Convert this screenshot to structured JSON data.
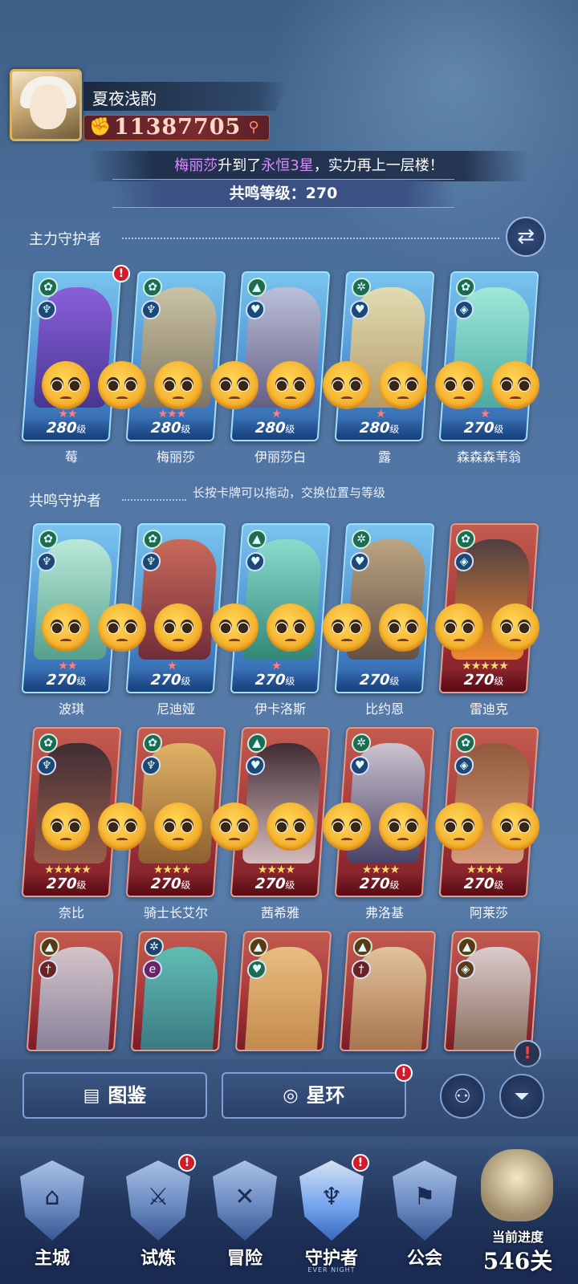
{
  "player": {
    "name": "夏夜浅酌",
    "power": "11387705"
  },
  "news": {
    "hero": "梅丽莎",
    "mid": "升到了",
    "rank": "永恒3星",
    "tail": "，实力再上一层楼！"
  },
  "resonance_level": "共鸣等级：270",
  "sections": {
    "main": "主力守护者",
    "resonance": "共鸣守护者",
    "hint": "长按卡牌可以拖动，交换位置与等级"
  },
  "level_unit": "级",
  "main_cards": [
    {
      "name": "莓",
      "level": "280",
      "stars": "★★"
    },
    {
      "name": "梅丽莎",
      "level": "280",
      "stars": "★★★"
    },
    {
      "name": "伊丽莎白",
      "level": "280",
      "stars": "★"
    },
    {
      "name": "露",
      "level": "280",
      "stars": "★"
    },
    {
      "name": "森森森苇翁",
      "level": "270",
      "stars": "★"
    }
  ],
  "resonance_row1": [
    {
      "name": "波琪",
      "level": "270",
      "stars": "★★"
    },
    {
      "name": "尼迪娅",
      "level": "270",
      "stars": "★"
    },
    {
      "name": "伊卡洛斯",
      "level": "270",
      "stars": "★"
    },
    {
      "name": "比约恩",
      "level": "270",
      "stars": ""
    },
    {
      "name": "雷迪克",
      "level": "270",
      "stars": "★★★★★"
    }
  ],
  "resonance_row2": [
    {
      "name": "奈比",
      "level": "270",
      "stars": "★★★★★"
    },
    {
      "name": "骑士长艾尔",
      "level": "270",
      "stars": "★★★★"
    },
    {
      "name": "茜希雅",
      "level": "270",
      "stars": "★★★★"
    },
    {
      "name": "弗洛基",
      "level": "270",
      "stars": "★★★★"
    },
    {
      "name": "阿莱莎",
      "level": "270",
      "stars": "★★★★"
    }
  ],
  "buttons": {
    "codex": "图鉴",
    "star_ring": "星环"
  },
  "nav": {
    "city": "主城",
    "trial": "试炼",
    "adventure": "冒险",
    "guardian": "守护者",
    "guild": "公会",
    "sub": "EVER NIGHT"
  },
  "progress": {
    "label": "当前进度",
    "value": "546关"
  },
  "icons": {
    "power": "fist-icon",
    "search": "magnifier-icon",
    "swap": "swap-arrows-icon",
    "codex": "book-icon",
    "star_ring": "ring-icon",
    "filter": "filter-icon",
    "formation": "person-icon",
    "alert": "exclamation-icon"
  },
  "colors": {
    "accent_purple": "#d98bff",
    "card_blue": "#4f8fd1",
    "card_red": "#a8383a",
    "alert_red": "#d21c2c"
  }
}
